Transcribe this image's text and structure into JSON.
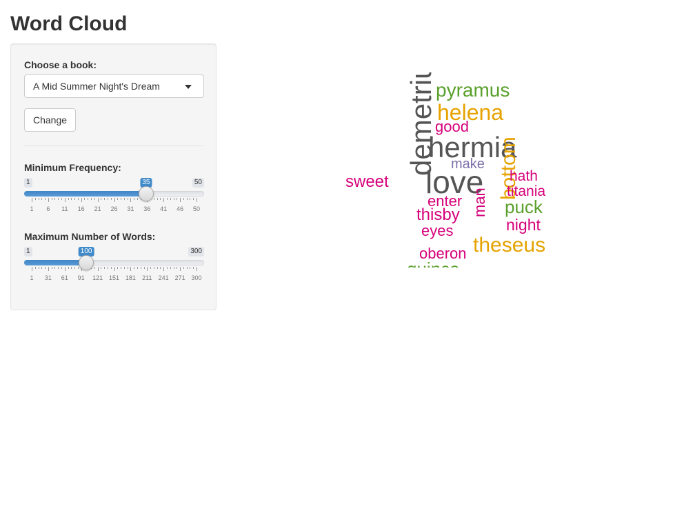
{
  "title": "Word Cloud",
  "sidebar": {
    "book_label": "Choose a book:",
    "book_selected": "A Mid Summer Night's Dream",
    "change_label": "Change",
    "min_freq": {
      "label": "Minimum Frequency:",
      "min": 1,
      "max": 50,
      "value": 35,
      "min_text": "1",
      "max_text": "50",
      "value_text": "35",
      "ticks": [
        "1",
        "6",
        "11",
        "16",
        "21",
        "26",
        "31",
        "36",
        "41",
        "46",
        "50"
      ]
    },
    "max_words": {
      "label": "Maximum Number of Words:",
      "min": 1,
      "max": 300,
      "value": 100,
      "min_text": "1",
      "max_text": "300",
      "value_text": "100",
      "ticks": [
        "1",
        "31",
        "61",
        "91",
        "121",
        "151",
        "181",
        "211",
        "241",
        "271",
        "300"
      ]
    }
  },
  "colors": {
    "accent": "#428bca"
  },
  "wordcloud": {
    "words": [
      {
        "text": "pyramus",
        "color": "#5aa02c"
      },
      {
        "text": "helena",
        "color": "#e6a300"
      },
      {
        "text": "good",
        "color": "#d6007a"
      },
      {
        "text": "demetrius",
        "color": "#555555"
      },
      {
        "text": "hermia",
        "color": "#555555"
      },
      {
        "text": "make",
        "color": "#7b6fa8"
      },
      {
        "text": "love",
        "color": "#555555"
      },
      {
        "text": "sweet",
        "color": "#d6007a"
      },
      {
        "text": "bottom",
        "color": "#e6a300"
      },
      {
        "text": "hath",
        "color": "#d6007a"
      },
      {
        "text": "titania",
        "color": "#d6007a"
      },
      {
        "text": "enter",
        "color": "#d6007a"
      },
      {
        "text": "man",
        "color": "#d6007a"
      },
      {
        "text": "puck",
        "color": "#5aa02c"
      },
      {
        "text": "thisby",
        "color": "#d6007a"
      },
      {
        "text": "eyes",
        "color": "#d6007a"
      },
      {
        "text": "night",
        "color": "#d6007a"
      },
      {
        "text": "theseus",
        "color": "#e6a300"
      },
      {
        "text": "oberon",
        "color": "#d6007a"
      },
      {
        "text": "quince",
        "color": "#5aa02c"
      }
    ]
  }
}
